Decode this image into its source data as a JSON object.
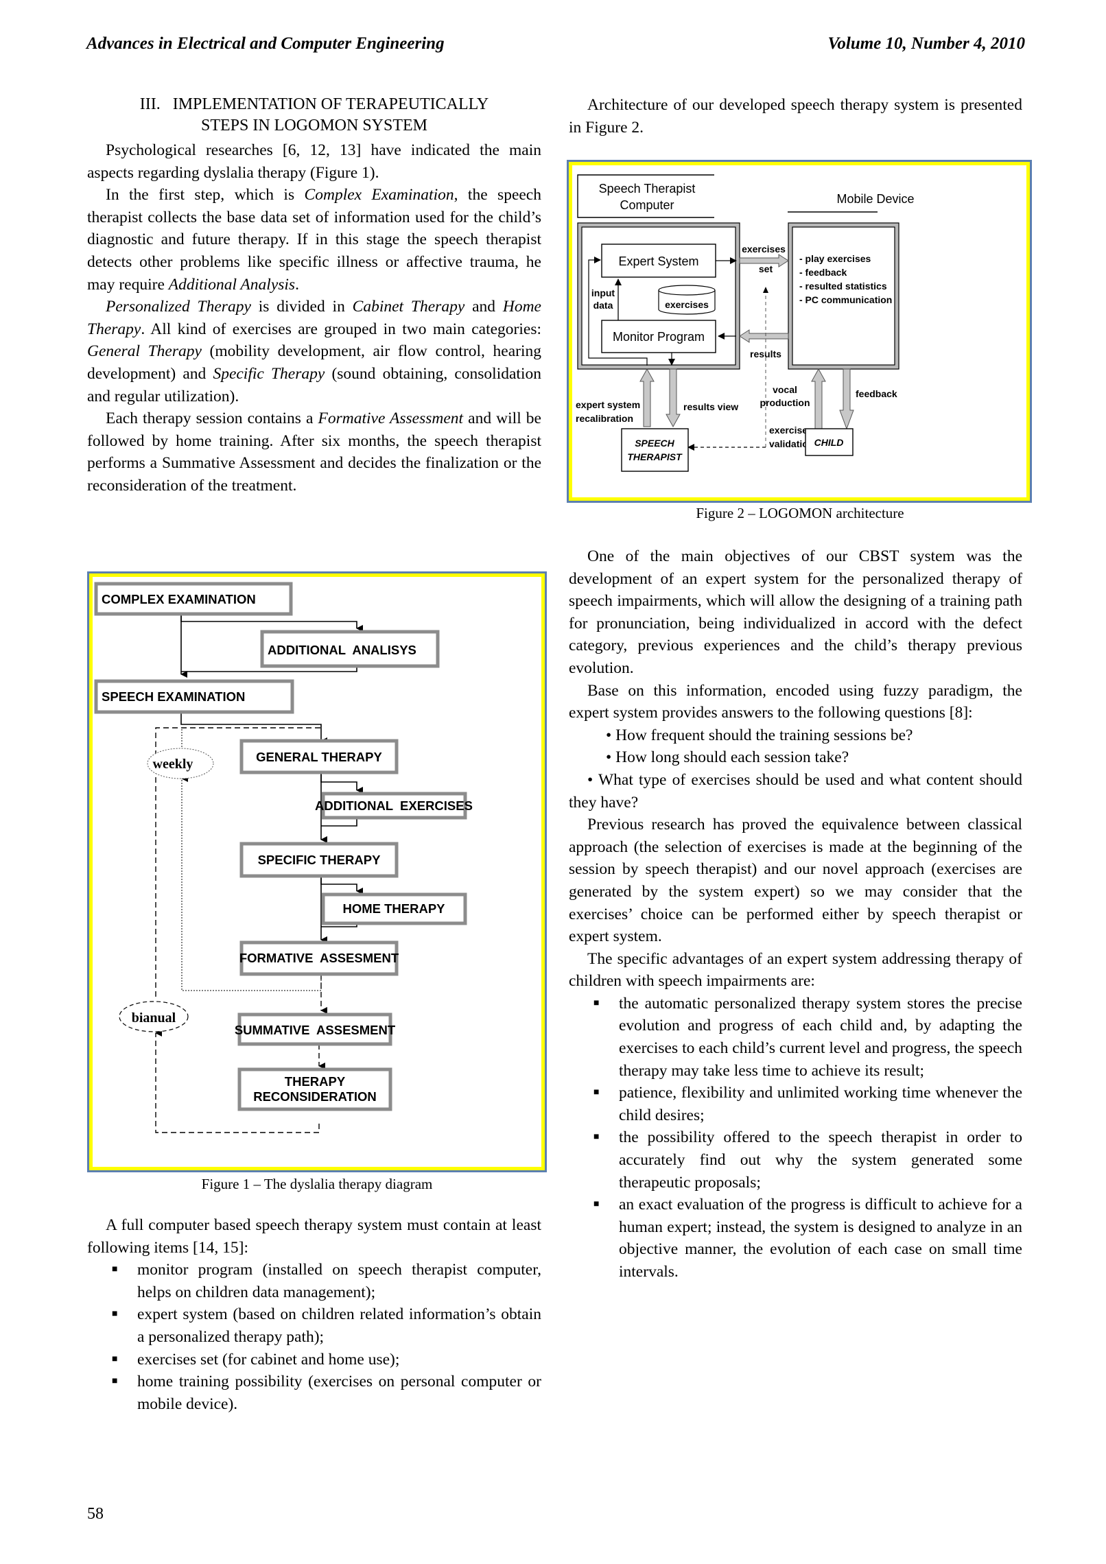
{
  "header": {
    "journal": "Advances in Electrical and Computer Engineering",
    "volume": "Volume 10, Number 4, 2010"
  },
  "section": {
    "number": "III.",
    "title_line1": "IMPLEMENTATION OF TERAPEUTICALLY",
    "title_line2": "STEPS IN LOGOMON SYSTEM"
  },
  "left_column": {
    "p1": "Psychological researches [6, 12, 13] have indicated the main aspects regarding dyslalia therapy (Figure 1).",
    "p2_a": "In the first step, which is ",
    "p2_it1": "Complex Examination",
    "p2_b": ", the speech therapist collects the base data set of information used for the child’s diagnostic and future therapy. If in this stage the speech therapist detects other problems like specific illness or affective trauma, he may require ",
    "p2_it2": "Additional Analysis",
    "p2_c": ".",
    "p3_it1": "Personalized Therapy",
    "p3_a": " is divided in ",
    "p3_it2": "Cabinet Therapy",
    "p3_b": " and ",
    "p3_it3": "Home Therapy",
    "p3_c": ". All kind of exercises are grouped in two main categories: ",
    "p3_it4": "General Therapy",
    "p3_d": " (mobility development, air flow control, hearing development) and ",
    "p3_it5": "Specific Therapy",
    "p3_e": " (sound obtaining, consolidation and regular utilization).",
    "p4_a": "Each therapy session contains a ",
    "p4_it1": "Formative Assessment",
    "p4_b": " and will be followed by home training. After six months, the speech therapist performs a Summative Assessment and decides the finalization or the reconsideration of the treatment.",
    "p5": "A full computer based speech therapy system must contain at least following items [14, 15]:",
    "bullets": [
      "monitor program (installed on speech therapist computer, helps on children data management);",
      "expert system (based on children related information’s obtain a personalized therapy path);",
      "exercises set (for cabinet and home use);",
      "home training possibility (exercises on personal computer or mobile device)."
    ],
    "bullet_glyph": "■"
  },
  "figure1": {
    "caption": "Figure 1 – The dyslalia therapy diagram",
    "boxes": {
      "complex_examination": "COMPLEX EXAMINATION",
      "additional_analisys": "ADDITIONAL  ANALISYS",
      "speech_examination": "SPEECH EXAMINATION",
      "general_therapy": "GENERAL THERAPY",
      "additional_exercises": "ADDITIONAL  EXERCISES",
      "specific_therapy": "SPECIFIC THERAPY",
      "home_therapy": "HOME THERAPY",
      "formative_assesment": "FORMATIVE  ASSESMENT",
      "summative_assesment": "SUMMATIVE  ASSESMENT",
      "therapy_reconsideration_1": "THERAPY",
      "therapy_reconsideration_2": "RECONSIDERATION"
    },
    "loops": {
      "weekly": "weekly",
      "bianual": "bianual"
    }
  },
  "right_column": {
    "p0": "Architecture of our developed speech therapy system is presented in Figure 2.",
    "p1": "One of the main objectives of our CBST system was the development of an expert system for the personalized therapy of speech impairments, which will allow the designing of a training path for pronunciation, being individualized in accord with the defect category, previous experiences and the child’s therapy previous evolution.",
    "p2": "Base on this information, encoded using fuzzy paradigm, the expert system provides answers to the following questions [8]:",
    "questions": [
      "• How frequent should the training sessions be?",
      "• How long should each session take?",
      "• What type of exercises should be used and what content should they have?"
    ],
    "p3": "Previous research has proved the equivalence between classical approach (the selection of exercises is made at the beginning of the session by speech therapist) and our novel approach (exercises are generated by the system expert) so we may consider that the exercises’ choice can be performed either by speech therapist or expert system.",
    "p4": "The specific advantages of an expert system addressing therapy of children with speech impairments are:",
    "bullets": [
      "the automatic personalized therapy system stores the precise evolution and progress of each child and, by adapting the exercises to each child’s current level and progress, the speech therapy may take less time to achieve its result;",
      "patience, flexibility and unlimited working time whenever the child desires;",
      "the possibility offered to the speech therapist in order to accurately find out why the system generated some therapeutic proposals;",
      "an exact evaluation of the progress is difficult to achieve for a human expert; instead, the system is designed to analyze in an objective manner, the evolution of each case on small time intervals."
    ],
    "bullet_glyph": "■"
  },
  "figure2": {
    "caption": "Figure 2 – LOGOMON architecture",
    "labels": {
      "st_computer_1": "Speech Therapist",
      "st_computer_2": "Computer",
      "mobile_device": "Mobile Device",
      "expert_system": "Expert System",
      "exercises_db": "exercises",
      "monitor_program": "Monitor Program",
      "input_1": "input",
      "input_2": "data",
      "exercises_set_1": "exercises",
      "exercises_set_2": "set",
      "results": "results",
      "mobile_items": [
        "- play exercises",
        "- feedback",
        "- resulted statistics",
        "- PC communication"
      ],
      "recal_1": "expert system",
      "recal_2": "recalibration",
      "results_view": "results view",
      "vocal_1": "vocal",
      "vocal_2": "production",
      "feedback": "feedback",
      "validation_1": "exercises",
      "validation_2": "validation",
      "speech_therapist_1": "SPEECH",
      "speech_therapist_2": "THERAPIST",
      "child": "CHILD"
    }
  },
  "footer": {
    "page_number": "58"
  },
  "colors": {
    "figure_frame_outer": "#5b7fb0",
    "figure_frame_inner": "#ffff00",
    "box_border_gray": "#8c8c8c",
    "arrow_gray": "#c8c8c8"
  }
}
